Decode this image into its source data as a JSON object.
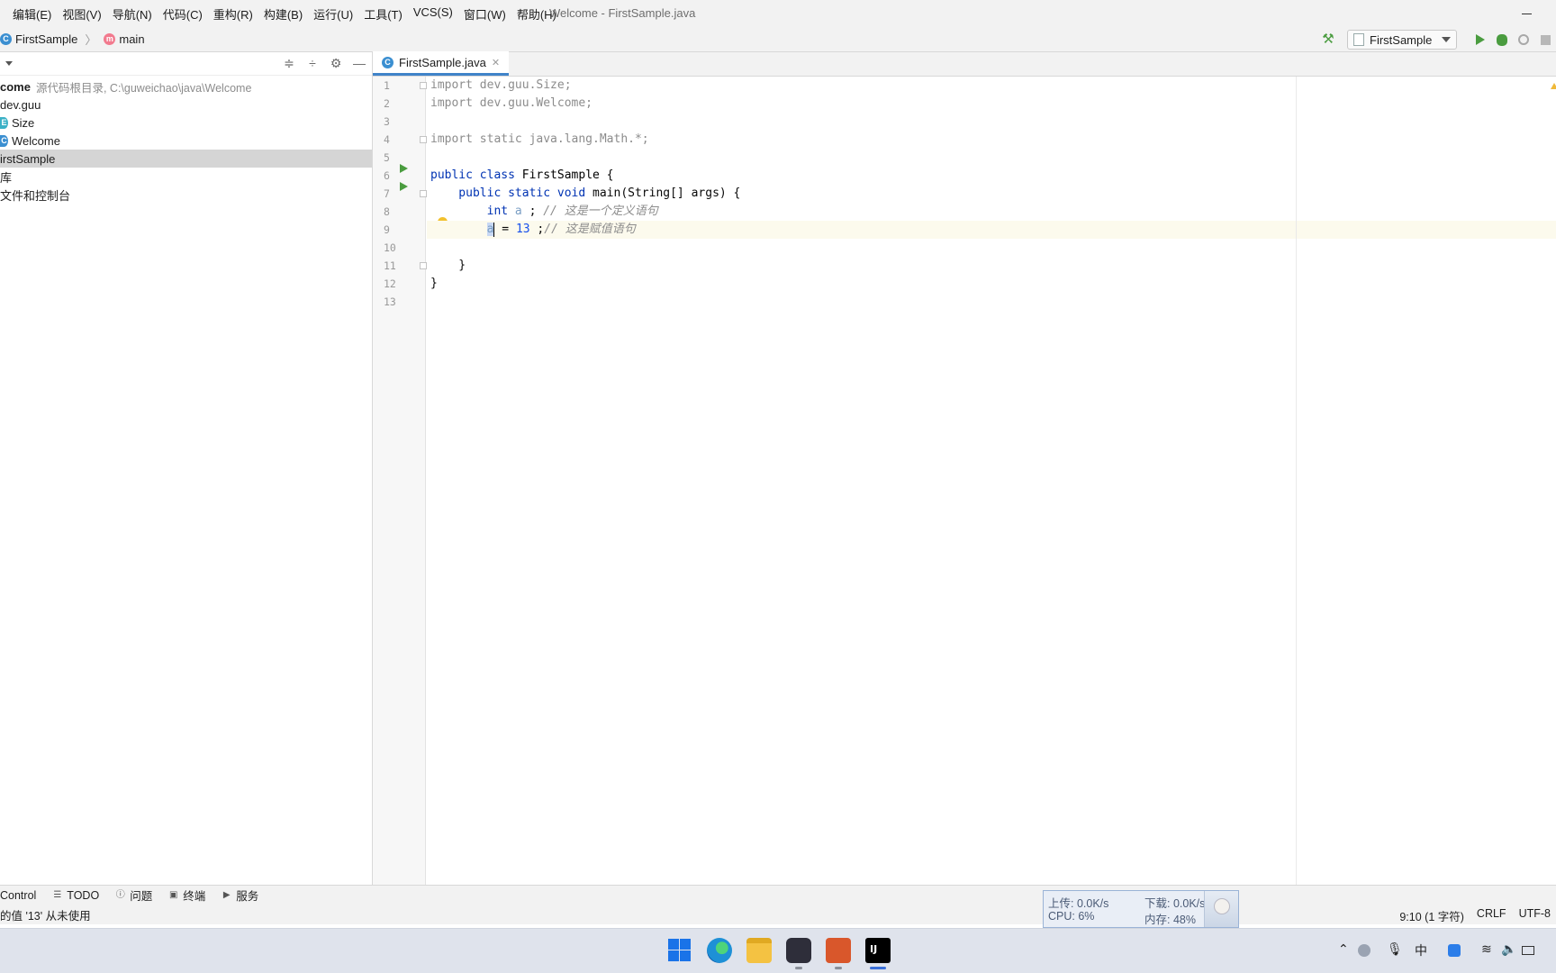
{
  "window": {
    "title": "Welcome - FirstSample.java"
  },
  "menu": [
    "编辑(E)",
    "视图(V)",
    "导航(N)",
    "代码(C)",
    "重构(R)",
    "构建(B)",
    "运行(U)",
    "工具(T)",
    "VCS(S)",
    "窗口(W)",
    "帮助(H)"
  ],
  "breadcrumb": {
    "class_icon": "C",
    "class_name": "FirstSample",
    "method_icon": "m",
    "method_name": "main"
  },
  "toolbar": {
    "run_config": "FirstSample"
  },
  "project_tree": {
    "rows": [
      {
        "text": "come",
        "extra": "源代码根目录, C:\\guweichao\\java\\Welcome",
        "bold": true
      },
      {
        "text": "dev.guu"
      },
      {
        "text": "Size",
        "icon": "E"
      },
      {
        "text": "Welcome",
        "icon": "C"
      },
      {
        "text": "irstSample",
        "selected": true
      },
      {
        "text": "库"
      },
      {
        "text": "文件和控制台"
      }
    ]
  },
  "editor": {
    "tab_label": "FirstSample.java",
    "line_numbers": [
      "1",
      "2",
      "3",
      "4",
      "5",
      "6",
      "7",
      "8",
      "9",
      "10",
      "11",
      "12",
      "13"
    ],
    "lines": {
      "l1": "import dev.guu.Size;",
      "l2": "import dev.guu.Welcome;",
      "l4": "import static java.lang.Math.*;",
      "l6_kw": "public class ",
      "l6_name": "FirstSample",
      "l6_brace": " {",
      "l7_kw": "    public static void ",
      "l7_rest": "main(String[] args) {",
      "l8_kw": "        int ",
      "l8_var": "a",
      "l8_semi": " ; ",
      "l8_comment": "// 这是一个定义语句",
      "l9_var": "a",
      "l9_eq": " = ",
      "l9_num": "13",
      "l9_semi": " ;",
      "l9_comment": "// 这是赋值语句",
      "l11": "    }",
      "l12": "}"
    }
  },
  "tool_windows": [
    {
      "label": "Control",
      "icon": "vcs-icon"
    },
    {
      "label": "TODO",
      "icon": "list-icon"
    },
    {
      "label": "问题",
      "icon": "info-icon"
    },
    {
      "label": "终端",
      "icon": "terminal-icon"
    },
    {
      "label": "服务",
      "icon": "services-icon"
    }
  ],
  "status": {
    "message": "的值 '13' 从未使用",
    "position": "9:10 (1 字符)",
    "line_sep": "CRLF",
    "encoding": "UTF-8"
  },
  "net_widget": {
    "upload": "上传: 0.0K/s",
    "download": "下载: 0.0K/s",
    "cpu": "CPU: 6%",
    "mem": "内存: 48%"
  },
  "taskbar": {
    "ime": "中"
  },
  "colors": {
    "accent": "#4083c9",
    "run_green": "#4a9c3f",
    "keyword": "#0033b3",
    "comment": "#8c8c8c"
  }
}
